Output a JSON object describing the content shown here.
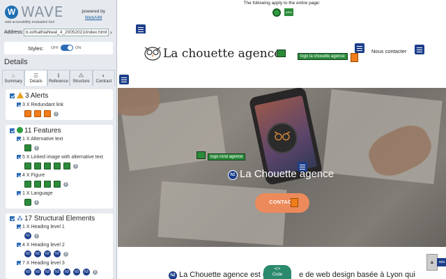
{
  "wave": {
    "logo_letter": "W",
    "title": "WAVE",
    "subtitle": "web accessibility evaluation tool",
    "powered_by": "powered by",
    "webaim": "WebAIM",
    "address_label": "Address:",
    "address_value": "b.io/KathiaNwal_4_20052021/index.html",
    "styles_label": "Styles:",
    "styles_off": "OFF",
    "styles_on": "ON",
    "details_title": "Details"
  },
  "tabs": [
    {
      "label": "Summary",
      "icon": "home-icon",
      "glyph": "⌂"
    },
    {
      "label": "Details",
      "icon": "list-icon",
      "glyph": "☰"
    },
    {
      "label": "Reference",
      "icon": "info-icon",
      "glyph": "ℹ"
    },
    {
      "label": "Structure",
      "icon": "structure-icon",
      "glyph": "⁂"
    },
    {
      "label": "Contrast",
      "icon": "contrast-icon",
      "glyph": "◐"
    }
  ],
  "alerts": {
    "heading": "3 Alerts",
    "items": [
      {
        "label": "3 X Redundant link",
        "count": 3
      }
    ]
  },
  "features": {
    "heading": "11 Features",
    "items": [
      {
        "label": "1 X Alternative text",
        "count": 1
      },
      {
        "label": "5 X Linked image with alternative text",
        "count": 5
      },
      {
        "label": "4 X Figure",
        "count": 4
      },
      {
        "label": "1 X Language",
        "count": 1
      }
    ]
  },
  "structure": {
    "heading": "17 Structural Elements",
    "items": [
      {
        "label": "1 X Heading level 1",
        "count": 1,
        "badge": "h1"
      },
      {
        "label": "4 X Heading level 2",
        "count": 4,
        "badge": "h2"
      },
      {
        "label": "7 X Heading level 3",
        "count": 7,
        "badge": "h3"
      }
    ]
  },
  "page": {
    "note": "The following apply to the entire page:",
    "brand": "La chouette agence",
    "logo_alt": "logo la chouette agence",
    "nav_contact": "Nous contacter",
    "round_logo_alt": "logo rond agence",
    "hero_title": "La Chouette agence",
    "h1_badge": "h1",
    "cta": "CONTACT",
    "h2_badge": "h2",
    "h2_text_left": "La Chouette agence est un",
    "h2_text_right": "e de web design basée à Lyon qui",
    "code_label": "Code",
    "code_glyph": "</>",
    "aria_label": "aria",
    "aria_icon_label": "ARIA",
    "scroll_glyph": "▲",
    "go_glyph": "›"
  },
  "colors": {
    "accent": "#2d6cb5",
    "alert": "#f07c1a",
    "feature": "#2c8a3b",
    "structure": "#1c3e8a",
    "cta": "#ec8a5c"
  }
}
